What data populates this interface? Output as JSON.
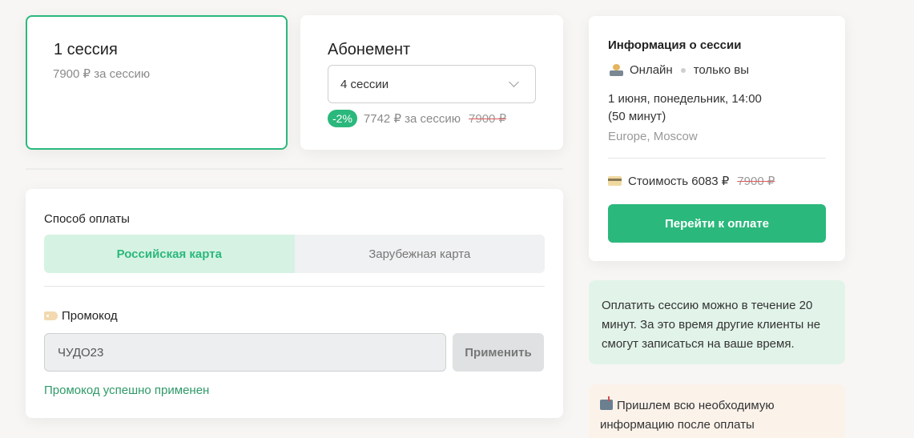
{
  "tariffs": {
    "single": {
      "title": "1 сессия",
      "price": "7900 ₽ за сессию"
    },
    "subscription": {
      "title": "Абонемент",
      "selected_option": "4 сессии",
      "discount": "-2%",
      "price": "7742 ₽ за сессию",
      "old_price": "7900 ₽"
    }
  },
  "payment": {
    "method_label": "Способ оплаты",
    "tabs": [
      {
        "label": "Российская карта",
        "active": true
      },
      {
        "label": "Зарубежная карта",
        "active": false
      }
    ],
    "promo_label": "Промокод",
    "promo_value": "ЧУДО23",
    "apply_label": "Применить",
    "promo_success": "Промокод успешно применен"
  },
  "session_info": {
    "heading": "Информация о сессии",
    "mode": "Онлайн",
    "participants": "только вы",
    "datetime": "1 июня, понедельник, 14:00",
    "duration": "(50 минут)",
    "timezone": "Europe, Moscow",
    "cost_label": "Стоимость 6083 ₽",
    "cost_old": "7900 ₽",
    "pay_button": "Перейти к оплате"
  },
  "notices": {
    "payment_window": "Оплатить сессию можно в течение 20 минут. За это время другие клиенты не смогут записаться на ваше время.",
    "info_after": "Пришлем всю необходимую информацию после оплаты"
  },
  "colors": {
    "accent": "#2bb87c",
    "accent_light": "#d6f2e3",
    "strike": "#e05a5a"
  },
  "icons": {
    "promo": "tag-icon",
    "mode": "laptop-person-icon",
    "cost": "credit-card-icon",
    "mail": "mailbox-icon",
    "select": "chevron-down-icon"
  }
}
